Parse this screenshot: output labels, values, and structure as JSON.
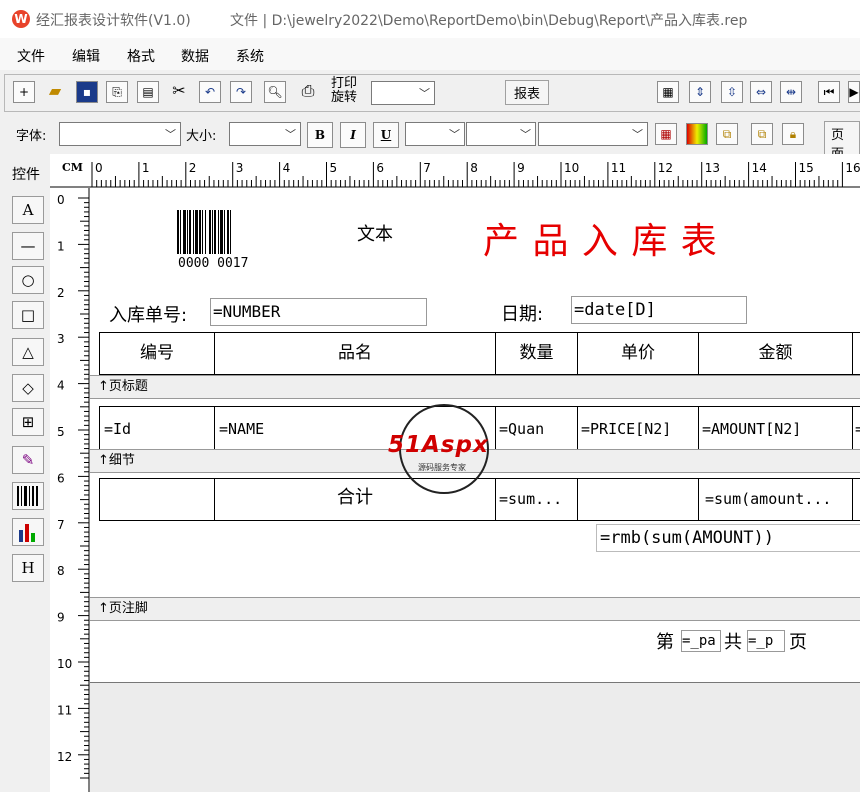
{
  "titlebar": {
    "app_icon_letter": "W",
    "title": "经汇报表设计软件(V1.0)",
    "path": "文件 | D:\\jewelry2022\\Demo\\ReportDemo\\bin\\Debug\\Report\\产品入库表.rep"
  },
  "menu": [
    "文件",
    "编辑",
    "格式",
    "数据",
    "系统"
  ],
  "toolbar1": {
    "icons": [
      "new-icon",
      "open-icon",
      "save-icon",
      "copy-icon",
      "paste-icon",
      "cut-icon",
      "undo-icon",
      "redo-icon",
      "preview-icon",
      "print-icon"
    ],
    "print_rotate_label_1": "打印",
    "print_rotate_label_2": "旋转",
    "report_button": "报表"
  },
  "toolbar2": {
    "font_label": "字体:",
    "size_label": "大小:",
    "bold": "B",
    "italic": "I",
    "underline": "U",
    "page_button": "页面"
  },
  "palette": {
    "label": "控件",
    "items": [
      "A",
      "—",
      "○",
      "□",
      "△",
      "◇",
      "⊞",
      "",
      "",
      "",
      "H"
    ]
  },
  "ruler": {
    "unit": "CM",
    "h_ticks": [
      "0",
      "1",
      "2",
      "3",
      "4",
      "5",
      "6",
      "7",
      "8",
      "9",
      "10",
      "11",
      "12",
      "13",
      "14",
      "15",
      "16"
    ],
    "v_ticks": [
      "0",
      "1",
      "2",
      "3",
      "4",
      "5",
      "6",
      "7",
      "8",
      "9",
      "10",
      "11",
      "12"
    ]
  },
  "report": {
    "barcode_text": "0000 0017",
    "text_label": "文本",
    "title": "产 品 入 库 表",
    "title_color": "#e60000",
    "order_label": "入库单号:",
    "order_value": "=NUMBER",
    "date_label": "日期:",
    "date_value": "=date[D]",
    "headers": [
      "编号",
      "品名",
      "数量",
      "单价",
      "金额"
    ],
    "band_page_header": "↑页标题",
    "detail_cells": [
      "=Id",
      "=NAME",
      "=Quan",
      "=PRICE[N2]",
      "=AMOUNT[N2]",
      "="
    ],
    "band_detail": "↑细节",
    "total_label": "合计",
    "total_cells": [
      "=sum...",
      "=sum(amount..."
    ],
    "rmb": "=rmb(sum(AMOUNT))",
    "band_footer": "↑页注脚",
    "page_prefix": "第",
    "page_field_1": "=_pa",
    "page_mid": "共",
    "page_field_2": "=_p",
    "page_suffix": "页"
  },
  "watermark": {
    "logo": "51Aspx",
    "subtitle": "源码服务专家"
  }
}
